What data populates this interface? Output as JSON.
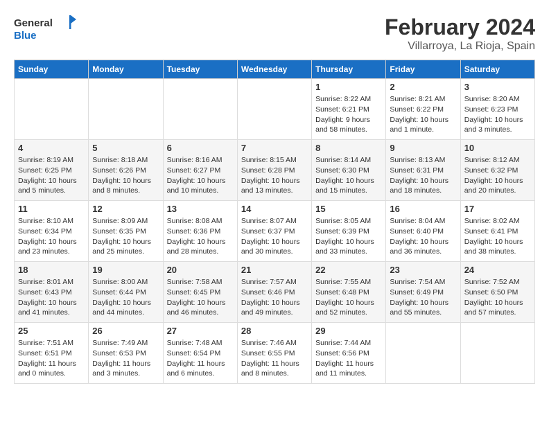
{
  "header": {
    "logo_general": "General",
    "logo_blue": "Blue",
    "title": "February 2024",
    "subtitle": "Villarroya, La Rioja, Spain"
  },
  "days_of_week": [
    "Sunday",
    "Monday",
    "Tuesday",
    "Wednesday",
    "Thursday",
    "Friday",
    "Saturday"
  ],
  "weeks": [
    [
      {
        "day": "",
        "empty": true
      },
      {
        "day": "",
        "empty": true
      },
      {
        "day": "",
        "empty": true
      },
      {
        "day": "",
        "empty": true
      },
      {
        "day": "1",
        "sunrise": "8:22 AM",
        "sunset": "6:21 PM",
        "daylight": "9 hours and 58 minutes."
      },
      {
        "day": "2",
        "sunrise": "8:21 AM",
        "sunset": "6:22 PM",
        "daylight": "10 hours and 1 minute."
      },
      {
        "day": "3",
        "sunrise": "8:20 AM",
        "sunset": "6:23 PM",
        "daylight": "10 hours and 3 minutes."
      }
    ],
    [
      {
        "day": "4",
        "sunrise": "8:19 AM",
        "sunset": "6:25 PM",
        "daylight": "10 hours and 5 minutes."
      },
      {
        "day": "5",
        "sunrise": "8:18 AM",
        "sunset": "6:26 PM",
        "daylight": "10 hours and 8 minutes."
      },
      {
        "day": "6",
        "sunrise": "8:16 AM",
        "sunset": "6:27 PM",
        "daylight": "10 hours and 10 minutes."
      },
      {
        "day": "7",
        "sunrise": "8:15 AM",
        "sunset": "6:28 PM",
        "daylight": "10 hours and 13 minutes."
      },
      {
        "day": "8",
        "sunrise": "8:14 AM",
        "sunset": "6:30 PM",
        "daylight": "10 hours and 15 minutes."
      },
      {
        "day": "9",
        "sunrise": "8:13 AM",
        "sunset": "6:31 PM",
        "daylight": "10 hours and 18 minutes."
      },
      {
        "day": "10",
        "sunrise": "8:12 AM",
        "sunset": "6:32 PM",
        "daylight": "10 hours and 20 minutes."
      }
    ],
    [
      {
        "day": "11",
        "sunrise": "8:10 AM",
        "sunset": "6:34 PM",
        "daylight": "10 hours and 23 minutes."
      },
      {
        "day": "12",
        "sunrise": "8:09 AM",
        "sunset": "6:35 PM",
        "daylight": "10 hours and 25 minutes."
      },
      {
        "day": "13",
        "sunrise": "8:08 AM",
        "sunset": "6:36 PM",
        "daylight": "10 hours and 28 minutes."
      },
      {
        "day": "14",
        "sunrise": "8:07 AM",
        "sunset": "6:37 PM",
        "daylight": "10 hours and 30 minutes."
      },
      {
        "day": "15",
        "sunrise": "8:05 AM",
        "sunset": "6:39 PM",
        "daylight": "10 hours and 33 minutes."
      },
      {
        "day": "16",
        "sunrise": "8:04 AM",
        "sunset": "6:40 PM",
        "daylight": "10 hours and 36 minutes."
      },
      {
        "day": "17",
        "sunrise": "8:02 AM",
        "sunset": "6:41 PM",
        "daylight": "10 hours and 38 minutes."
      }
    ],
    [
      {
        "day": "18",
        "sunrise": "8:01 AM",
        "sunset": "6:43 PM",
        "daylight": "10 hours and 41 minutes."
      },
      {
        "day": "19",
        "sunrise": "8:00 AM",
        "sunset": "6:44 PM",
        "daylight": "10 hours and 44 minutes."
      },
      {
        "day": "20",
        "sunrise": "7:58 AM",
        "sunset": "6:45 PM",
        "daylight": "10 hours and 46 minutes."
      },
      {
        "day": "21",
        "sunrise": "7:57 AM",
        "sunset": "6:46 PM",
        "daylight": "10 hours and 49 minutes."
      },
      {
        "day": "22",
        "sunrise": "7:55 AM",
        "sunset": "6:48 PM",
        "daylight": "10 hours and 52 minutes."
      },
      {
        "day": "23",
        "sunrise": "7:54 AM",
        "sunset": "6:49 PM",
        "daylight": "10 hours and 55 minutes."
      },
      {
        "day": "24",
        "sunrise": "7:52 AM",
        "sunset": "6:50 PM",
        "daylight": "10 hours and 57 minutes."
      }
    ],
    [
      {
        "day": "25",
        "sunrise": "7:51 AM",
        "sunset": "6:51 PM",
        "daylight": "11 hours and 0 minutes."
      },
      {
        "day": "26",
        "sunrise": "7:49 AM",
        "sunset": "6:53 PM",
        "daylight": "11 hours and 3 minutes."
      },
      {
        "day": "27",
        "sunrise": "7:48 AM",
        "sunset": "6:54 PM",
        "daylight": "11 hours and 6 minutes."
      },
      {
        "day": "28",
        "sunrise": "7:46 AM",
        "sunset": "6:55 PM",
        "daylight": "11 hours and 8 minutes."
      },
      {
        "day": "29",
        "sunrise": "7:44 AM",
        "sunset": "6:56 PM",
        "daylight": "11 hours and 11 minutes."
      },
      {
        "day": "",
        "empty": true
      },
      {
        "day": "",
        "empty": true
      }
    ]
  ],
  "labels": {
    "sunrise": "Sunrise:",
    "sunset": "Sunset:",
    "daylight": "Daylight hours"
  }
}
